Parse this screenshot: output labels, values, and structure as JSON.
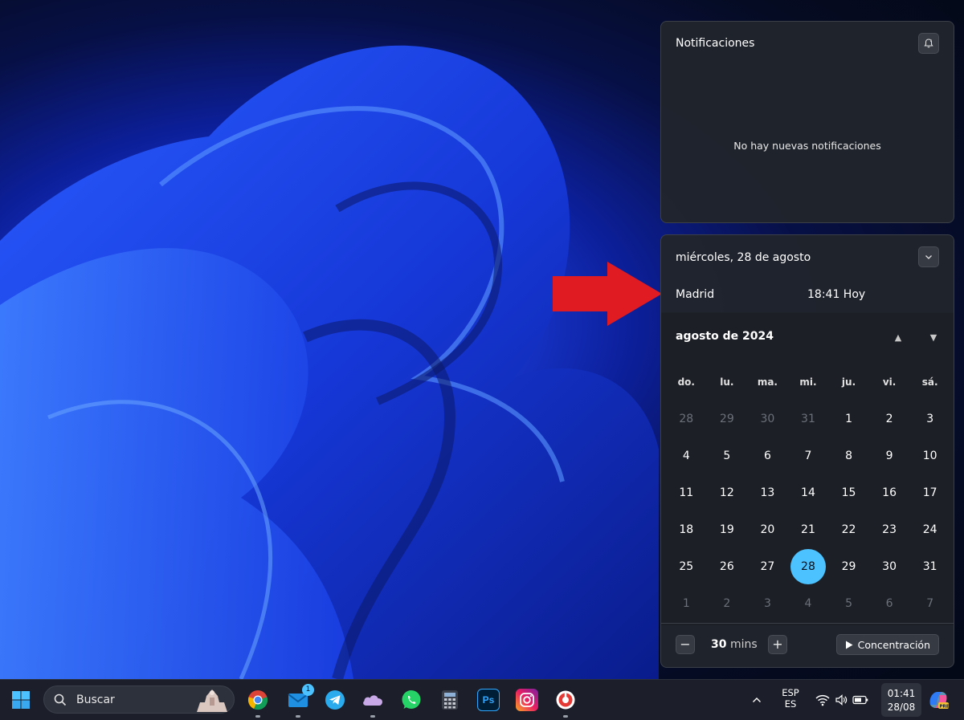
{
  "notifications": {
    "title": "Notificaciones",
    "empty_message": "No hay nuevas notificaciones"
  },
  "calendar": {
    "date_title": "miércoles, 28 de agosto",
    "city": "Madrid",
    "city_time": "18:41 Hoy",
    "month_label": "agosto de 2024",
    "weekdays": [
      "do.",
      "lu.",
      "ma.",
      "mi.",
      "ju.",
      "vi.",
      "sá."
    ],
    "weeks": [
      [
        "28",
        "29",
        "30",
        "31",
        "1",
        "2",
        "3"
      ],
      [
        "4",
        "5",
        "6",
        "7",
        "8",
        "9",
        "10"
      ],
      [
        "11",
        "12",
        "13",
        "14",
        "15",
        "16",
        "17"
      ],
      [
        "18",
        "19",
        "20",
        "21",
        "22",
        "23",
        "24"
      ],
      [
        "25",
        "26",
        "27",
        "28",
        "29",
        "30",
        "31"
      ],
      [
        "1",
        "2",
        "3",
        "4",
        "5",
        "6",
        "7"
      ]
    ],
    "today": "28",
    "accent_color": "#4cc2ff"
  },
  "focus": {
    "minus_label": "−",
    "minutes_value": "30",
    "minutes_unit": "mins",
    "plus_label": "+",
    "start_label": "Concentración"
  },
  "taskbar": {
    "search_placeholder": "Buscar",
    "mail_badge": "1",
    "language_top": "ESP",
    "language_bottom": "ES",
    "time": "01:41",
    "date": "28/08",
    "apps": [
      "chrome-icon",
      "mail-icon",
      "telegram-icon",
      "onedrive-icon",
      "whatsapp-icon",
      "calculator-icon",
      "photoshop-icon",
      "instagram-icon",
      "app-icon"
    ],
    "photoshop_label": "Ps"
  }
}
